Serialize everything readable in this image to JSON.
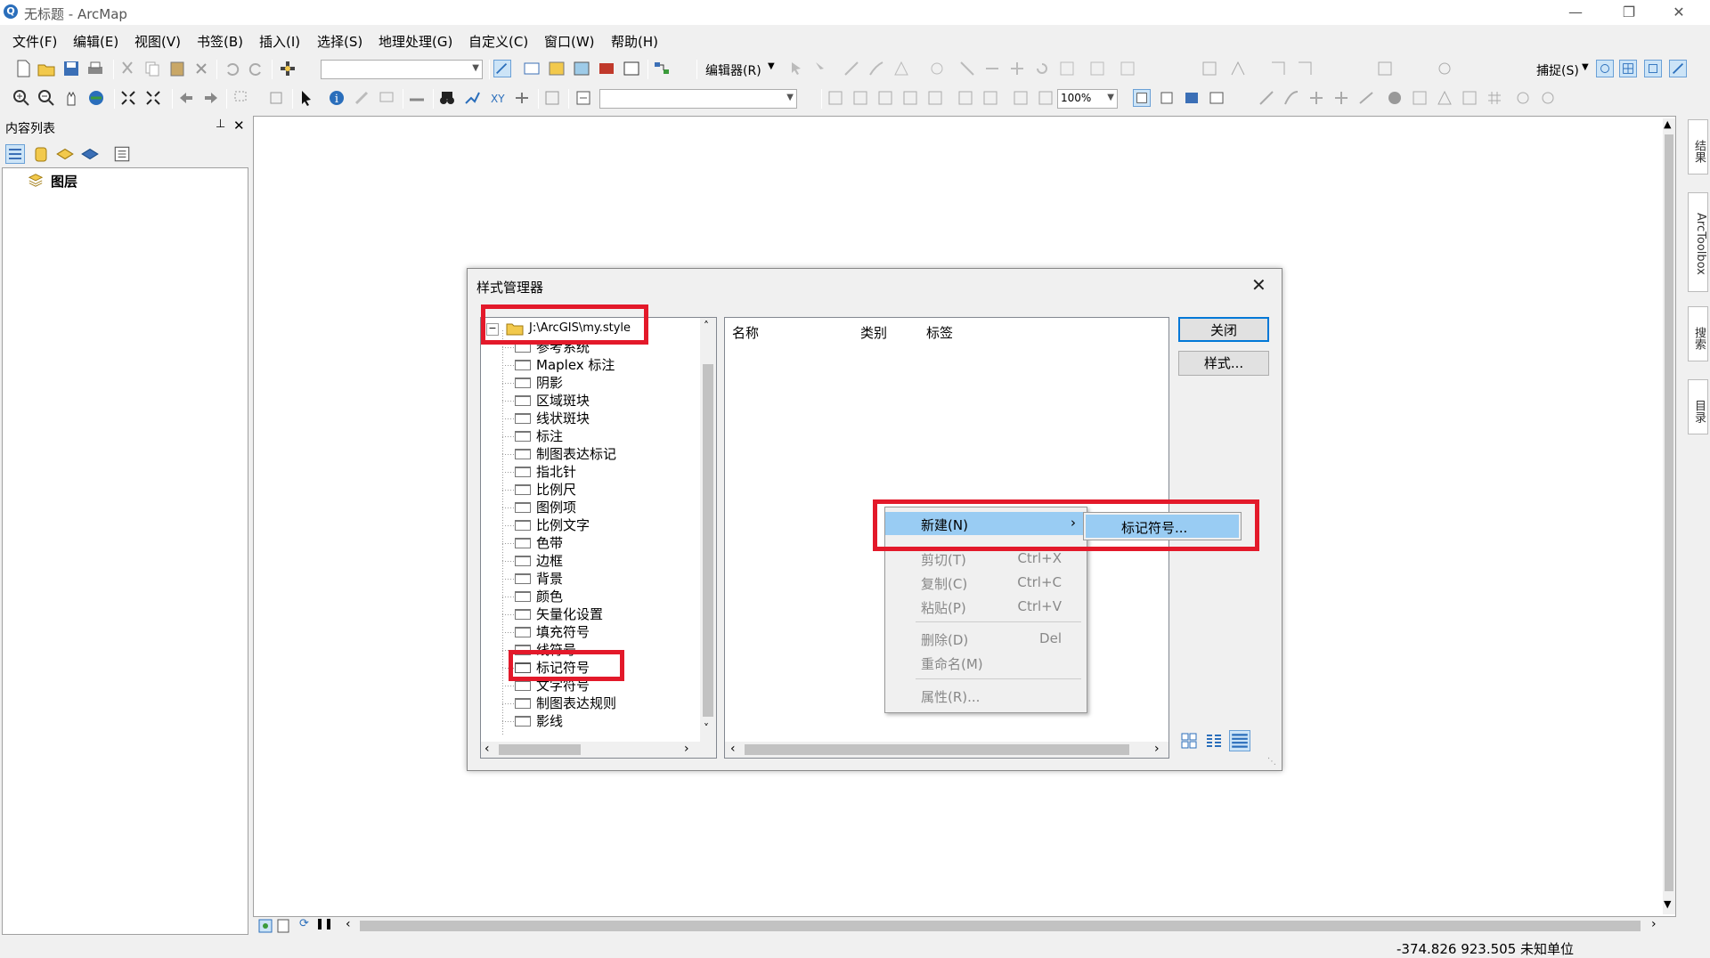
{
  "window": {
    "title": "无标题 - ArcMap"
  },
  "menubar": [
    "文件(F)",
    "编辑(E)",
    "视图(V)",
    "书签(B)",
    "插入(I)",
    "选择(S)",
    "地理处理(G)",
    "自定义(C)",
    "窗口(W)",
    "帮助(H)"
  ],
  "toolbar1": {
    "editor_label": "编辑器(R)",
    "snap_label": "捕捉(S)"
  },
  "toolbar2": {
    "zoom_value": "100%"
  },
  "toc": {
    "title": "内容列表",
    "root_label": "图层"
  },
  "right_dock": [
    "结果",
    "ArcToolbox",
    "搜索",
    "目录"
  ],
  "status": {
    "coords": "-374.826  923.505 未知单位"
  },
  "dialog": {
    "title": "样式管理器",
    "tree_root": "J:\\ArcGIS\\my.style",
    "tree_items": [
      "参考系统",
      "Maplex 标注",
      "阴影",
      "区域斑块",
      "线状斑块",
      "标注",
      "制图表达标记",
      "指北针",
      "比例尺",
      "图例项",
      "比例文字",
      "色带",
      "边框",
      "背景",
      "颜色",
      "矢量化设置",
      "填充符号",
      "线符号",
      "标记符号",
      "文字符号",
      "制图表达规则",
      "影线"
    ],
    "columns": [
      "名称",
      "类别",
      "标签"
    ],
    "close_button": "关闭",
    "styles_button": "样式..."
  },
  "context_menu": {
    "new_label": "新建(N)",
    "items": [
      {
        "label": "剪切(T)",
        "shortcut": "Ctrl+X"
      },
      {
        "label": "复制(C)",
        "shortcut": "Ctrl+C"
      },
      {
        "label": "粘贴(P)",
        "shortcut": "Ctrl+V"
      },
      {
        "label": "删除(D)",
        "shortcut": "Del"
      },
      {
        "label": "重命名(M)",
        "shortcut": ""
      },
      {
        "label": "属性(R)...",
        "shortcut": ""
      }
    ],
    "submenu_label": "标记符号..."
  },
  "colors": {
    "highlight": "#99ccf3",
    "annotation_red": "#e3192a",
    "accent": "#0078d7"
  }
}
